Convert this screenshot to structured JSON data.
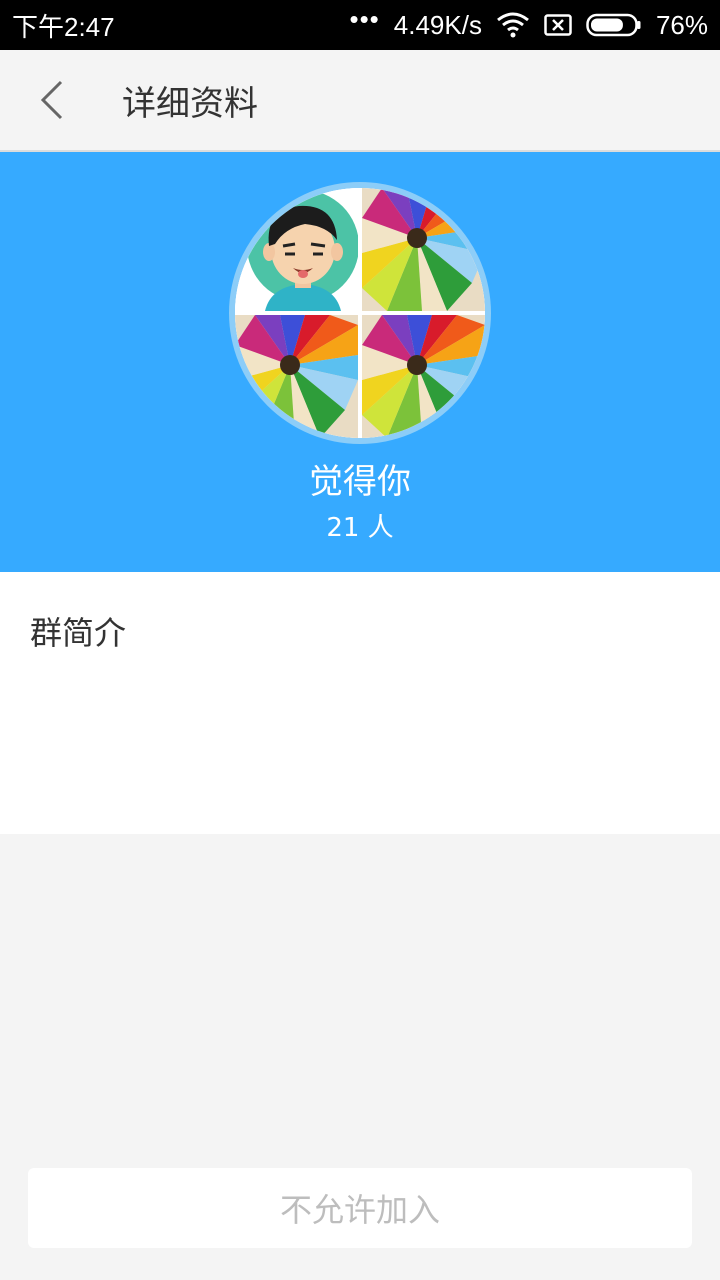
{
  "status_bar": {
    "time": "下午2:47",
    "network_speed": "4.49K/s",
    "battery_percent": "76%",
    "battery_level": 0.76,
    "icons": [
      "signal-dots-icon",
      "wifi-icon",
      "no-sim-icon",
      "battery-icon"
    ]
  },
  "app_bar": {
    "title": "详细资料",
    "back_icon": "chevron-left-icon"
  },
  "group": {
    "name": "觉得你",
    "member_count": "21 人",
    "avatar_tiles": [
      "cartoon-boy-avatar",
      "colored-pencils-image",
      "colored-pencils-image",
      "colored-pencils-image"
    ]
  },
  "intro": {
    "title": "群简介",
    "content": ""
  },
  "actions": {
    "join_label": "不允许加入"
  },
  "colors": {
    "header_blue": "#36aaff",
    "background": "#f4f4f4",
    "disabled_text": "#bdbdbd"
  }
}
